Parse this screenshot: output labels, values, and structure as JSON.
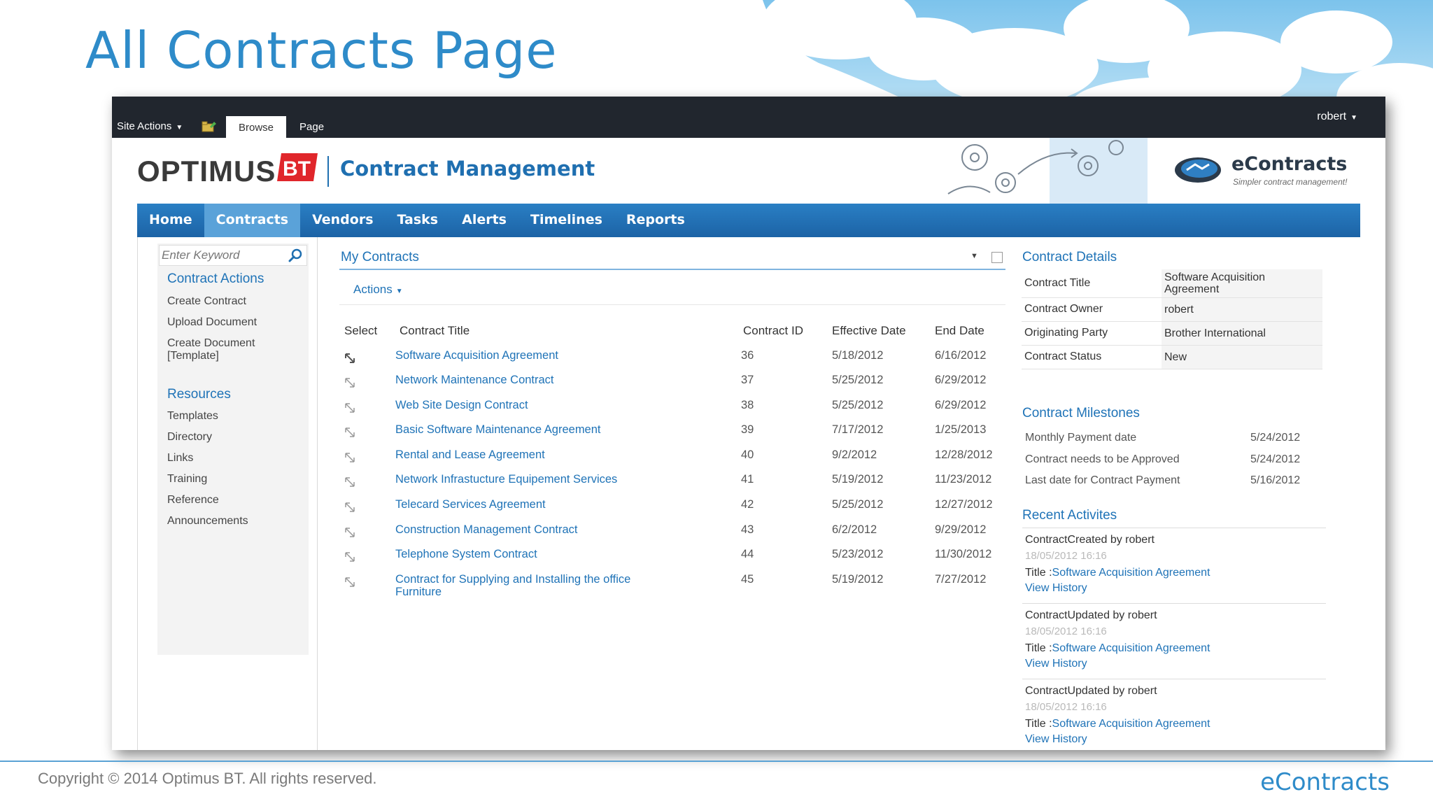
{
  "slide": {
    "title": "All Contracts Page",
    "copyright": "Copyright © 2014 Optimus BT. All rights reserved.",
    "brand": "eContracts"
  },
  "ribbon": {
    "site_actions": "Site Actions",
    "tabs": [
      "Browse",
      "Page"
    ],
    "user": "robert"
  },
  "header": {
    "logo_text": "OPTIMUS",
    "logo_mark": "BT",
    "site_title": "Contract Management",
    "product_name": "eContracts",
    "product_tagline": "Simpler contract management!"
  },
  "topnav": [
    "Home",
    "Contracts",
    "Vendors",
    "Tasks",
    "Alerts",
    "Timelines",
    "Reports"
  ],
  "topnav_active": "Contracts",
  "leftnav": {
    "search_placeholder": "Enter Keyword",
    "contract_actions_heading": "Contract Actions",
    "contract_actions": [
      "Create Contract",
      "Upload Document",
      "Create Document [Template]"
    ],
    "resources_heading": "Resources",
    "resources": [
      "Templates",
      "Directory",
      "Links",
      "Training",
      "Reference",
      "Announcements"
    ]
  },
  "my_contracts": {
    "title": "My Contracts",
    "actions_label": "Actions",
    "columns": [
      "Select",
      "Contract Title",
      "Contract ID",
      "Effective Date",
      "End Date"
    ],
    "rows": [
      {
        "title": "Software Acquisition Agreement",
        "id": "36",
        "effective": "5/18/2012",
        "end": "6/16/2012"
      },
      {
        "title": "Network Maintenance Contract",
        "id": "37",
        "effective": "5/25/2012",
        "end": "6/29/2012"
      },
      {
        "title": "Web Site Design Contract",
        "id": "38",
        "effective": "5/25/2012",
        "end": "6/29/2012"
      },
      {
        "title": "Basic Software Maintenance Agreement",
        "id": "39",
        "effective": "7/17/2012",
        "end": "1/25/2013"
      },
      {
        "title": "Rental and Lease Agreement",
        "id": "40",
        "effective": "9/2/2012",
        "end": "12/28/2012"
      },
      {
        "title": "Network Infrastucture Equipement Services",
        "id": "41",
        "effective": "5/19/2012",
        "end": "11/23/2012"
      },
      {
        "title": "Telecard Services Agreement",
        "id": "42",
        "effective": "5/25/2012",
        "end": "12/27/2012"
      },
      {
        "title": "Construction Management Contract",
        "id": "43",
        "effective": "6/2/2012",
        "end": "9/29/2012"
      },
      {
        "title": "Telephone System Contract",
        "id": "44",
        "effective": "5/23/2012",
        "end": "11/30/2012"
      },
      {
        "title": "Contract for Supplying and Installing the office Furniture",
        "id": "45",
        "effective": "5/19/2012",
        "end": "7/27/2012"
      }
    ]
  },
  "contract_details": {
    "heading": "Contract Details",
    "fields": [
      {
        "label": "Contract Title",
        "value": "Software Acquisition Agreement"
      },
      {
        "label": "Contract Owner",
        "value": "robert"
      },
      {
        "label": "Originating Party",
        "value": "Brother International"
      },
      {
        "label": "Contract Status",
        "value": "New"
      }
    ]
  },
  "milestones": {
    "heading": "Contract Milestones",
    "items": [
      {
        "label": "Monthly Payment date",
        "date": "5/24/2012"
      },
      {
        "label": "Contract needs to be Approved",
        "date": "5/24/2012"
      },
      {
        "label": "Last date for Contract Payment",
        "date": "5/16/2012"
      }
    ]
  },
  "activities": {
    "heading": "Recent Activites",
    "items": [
      {
        "event": "ContractCreated  by  robert",
        "time": "18/05/2012 16:16",
        "title_prefix": "Title :",
        "title_link": "Software Acquisition Agreement",
        "history": "View History"
      },
      {
        "event": "ContractUpdated  by  robert",
        "time": "18/05/2012 16:16",
        "title_prefix": "Title :",
        "title_link": "Software Acquisition Agreement",
        "history": "View History"
      },
      {
        "event": "ContractUpdated  by  robert",
        "time": "18/05/2012 16:16",
        "title_prefix": "Title :",
        "title_link": "Software Acquisition Agreement",
        "history": "View History"
      }
    ]
  },
  "colors": {
    "accent": "#1f73b7",
    "nav_bar": "#1c63a6",
    "nav_active": "#5aa2d9",
    "ribbon": "#21262e",
    "slide_title": "#2e8bc9",
    "logo_bt": "#e0262b"
  }
}
